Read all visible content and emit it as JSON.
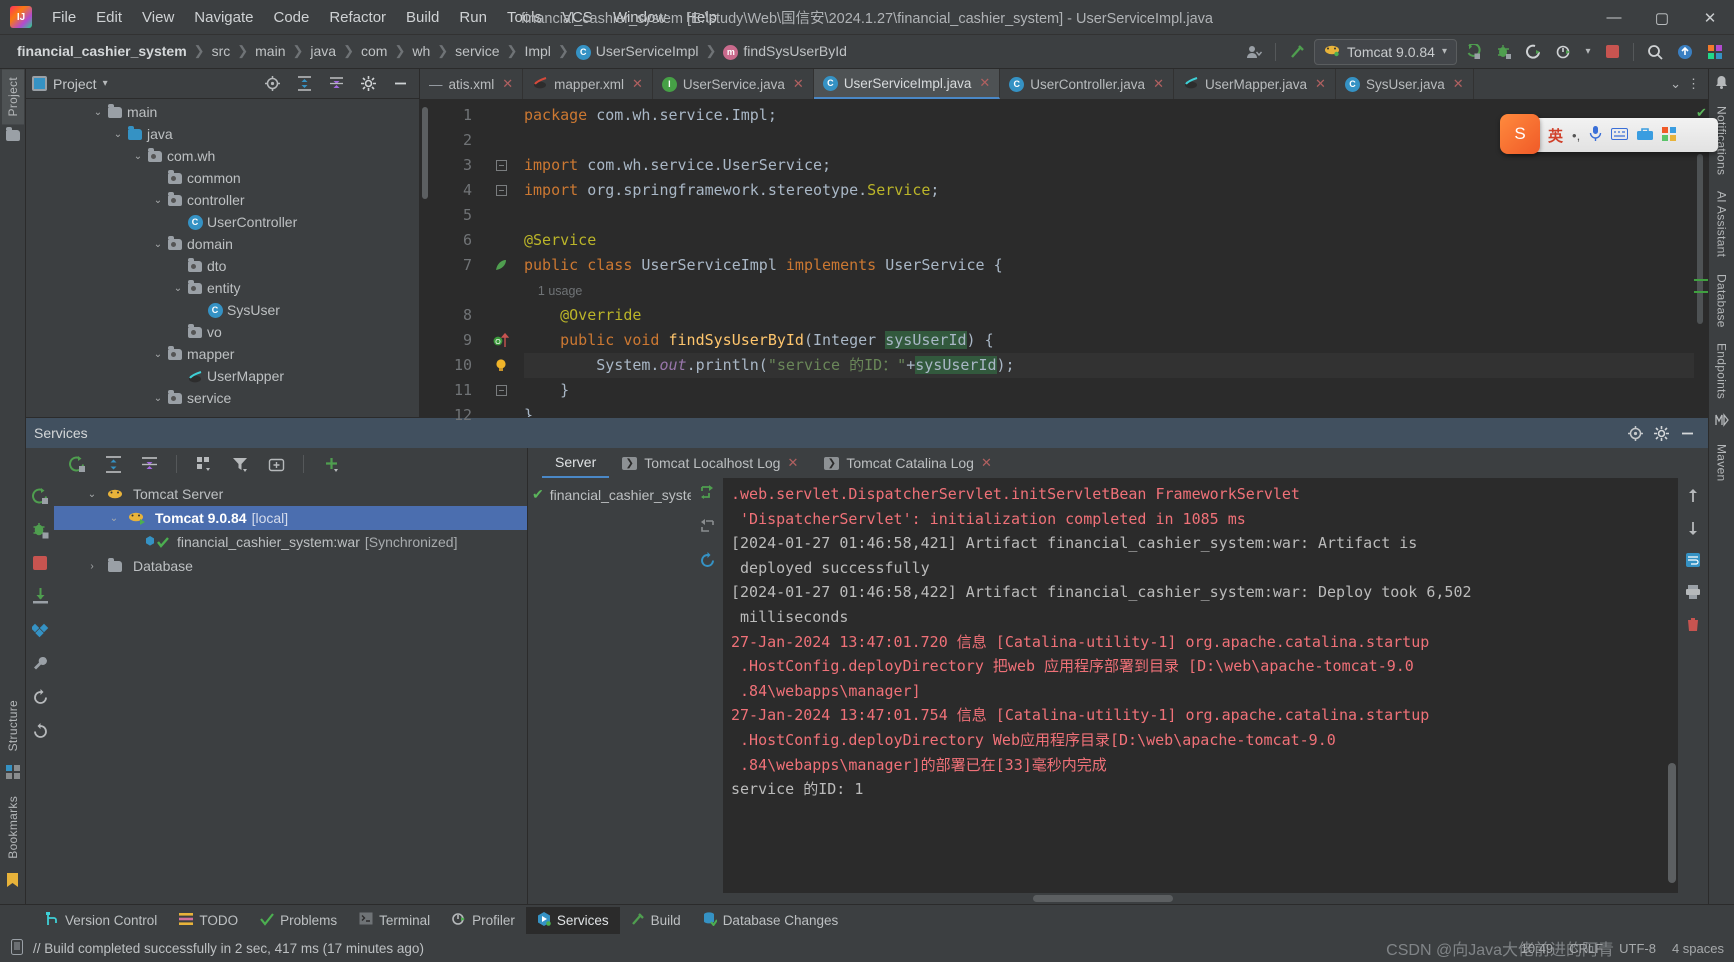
{
  "window": {
    "title": "financial_cashier_system [E:\\study\\Web\\国信安\\2024.1.27\\financial_cashier_system] - UserServiceImpl.java",
    "minimize": "—",
    "maximize": "▢",
    "close": "✕"
  },
  "menubar": [
    {
      "label": "File"
    },
    {
      "label": "Edit"
    },
    {
      "label": "View"
    },
    {
      "label": "Navigate"
    },
    {
      "label": "Code"
    },
    {
      "label": "Refactor"
    },
    {
      "label": "Build"
    },
    {
      "label": "Run"
    },
    {
      "label": "Tools"
    },
    {
      "label": "VCS"
    },
    {
      "label": "Window"
    },
    {
      "label": "Help"
    }
  ],
  "breadcrumb": [
    {
      "label": "financial_cashier_system",
      "icon": ""
    },
    {
      "label": "src",
      "icon": ""
    },
    {
      "label": "main",
      "icon": ""
    },
    {
      "label": "java",
      "icon": ""
    },
    {
      "label": "com",
      "icon": ""
    },
    {
      "label": "wh",
      "icon": ""
    },
    {
      "label": "service",
      "icon": ""
    },
    {
      "label": "Impl",
      "icon": ""
    },
    {
      "label": "UserServiceImpl",
      "icon": "C"
    },
    {
      "label": "findSysUserById",
      "icon": "m"
    }
  ],
  "navbar_right": {
    "account_icon": "account-icon",
    "build_icon": "build-hammer-icon",
    "run_config": "Tomcat 9.0.84",
    "run_icon": "run-icon",
    "debug_icon": "debug-icon",
    "rerun_icon": "rerun-icon",
    "profile_icon": "profile-icon",
    "stop_icon": "stop-icon",
    "search_icon": "search-icon",
    "update_icon": "update-icon"
  },
  "left_rail": [
    {
      "label": "Project",
      "active": true
    },
    {
      "label": "Structure",
      "active": false
    },
    {
      "label": "Bookmarks",
      "active": false
    }
  ],
  "right_rail": [
    {
      "label": "Notifications"
    },
    {
      "label": "AI Assistant"
    },
    {
      "label": "Database"
    },
    {
      "label": "Endpoints"
    },
    {
      "label": "Maven"
    }
  ],
  "project_panel": {
    "title": "Project",
    "tree": [
      {
        "depth": 3,
        "chevron": "v",
        "icon": "folder",
        "label": "main"
      },
      {
        "depth": 4,
        "chevron": "v",
        "icon": "folder-blue",
        "label": "java"
      },
      {
        "depth": 5,
        "chevron": "v",
        "icon": "package",
        "label": "com.wh"
      },
      {
        "depth": 6,
        "chevron": "",
        "icon": "package",
        "label": "common"
      },
      {
        "depth": 6,
        "chevron": "v",
        "icon": "package",
        "label": "controller"
      },
      {
        "depth": 7,
        "chevron": "",
        "icon": "class",
        "label": "UserController"
      },
      {
        "depth": 6,
        "chevron": "v",
        "icon": "package",
        "label": "domain"
      },
      {
        "depth": 7,
        "chevron": "",
        "icon": "package",
        "label": "dto"
      },
      {
        "depth": 7,
        "chevron": "v",
        "icon": "package",
        "label": "entity"
      },
      {
        "depth": 8,
        "chevron": "",
        "icon": "class",
        "label": "SysUser"
      },
      {
        "depth": 7,
        "chevron": "",
        "icon": "package",
        "label": "vo"
      },
      {
        "depth": 6,
        "chevron": "v",
        "icon": "package",
        "label": "mapper"
      },
      {
        "depth": 7,
        "chevron": "",
        "icon": "interface-java",
        "label": "UserMapper"
      },
      {
        "depth": 6,
        "chevron": "v",
        "icon": "package",
        "label": "service"
      }
    ]
  },
  "editor_tabs": [
    {
      "label": "atis.xml",
      "icon": "xml-icon",
      "active": false,
      "truncated": true
    },
    {
      "label": "mapper.xml",
      "icon": "mybatis-icon",
      "active": false
    },
    {
      "label": "UserService.java",
      "icon": "interface-icon",
      "active": false
    },
    {
      "label": "UserServiceImpl.java",
      "icon": "class-icon",
      "active": true
    },
    {
      "label": "UserController.java",
      "icon": "class-icon",
      "active": false
    },
    {
      "label": "UserMapper.java",
      "icon": "mybatis-mapper-icon",
      "active": false
    },
    {
      "label": "SysUser.java",
      "icon": "class-icon",
      "active": false
    }
  ],
  "editor": {
    "lines": [
      {
        "no": "1",
        "html": "<span class='kw'>package</span> com.wh.service.Impl;"
      },
      {
        "no": "2",
        "html": ""
      },
      {
        "no": "3",
        "html": "<span class='kw'>import</span> com.wh.service.UserService;"
      },
      {
        "no": "4",
        "html": "<span class='kw'>import</span> org.springframework.stereotype.<span class='ann'>Service</span>;"
      },
      {
        "no": "5",
        "html": ""
      },
      {
        "no": "6",
        "html": "<span class='ann'>@Service</span>"
      },
      {
        "no": "7",
        "html": "<span class='kw'>public class</span> UserServiceImpl <span class='kw'>implements</span> UserService {"
      },
      {
        "no": "",
        "html": "<span class='usage'>    1 usage</span>"
      },
      {
        "no": "8",
        "html": "    <span class='ann'>@Override</span>"
      },
      {
        "no": "9",
        "html": "    <span class='kw'>public void</span> <span class='fn'>findSysUserById</span>(Integer <span class='hl'>sysUserId</span>) {"
      },
      {
        "no": "10",
        "html": "        System.<span class='fld'>out</span>.println(<span class='str'>\"service 的ID：\"</span>+<span class='hl'>sysUserId</span>);"
      },
      {
        "no": "11",
        "html": "    }"
      },
      {
        "no": "12",
        "html": "}"
      }
    ],
    "usage_hint": "1 usage",
    "gutter_marks": [
      "",
      "",
      "fold",
      "fold",
      "",
      "",
      "spring-bean",
      "",
      "",
      "override-arrow",
      "intention-bulb",
      "fold-end",
      ""
    ]
  },
  "ime": {
    "app": "搜狗",
    "mode": "英",
    "items": [
      "英",
      "•,",
      "mic-icon",
      "keyboard-icon",
      "toolbox-icon",
      "apps-icon"
    ]
  },
  "services": {
    "title": "Services",
    "toolbar_icons": [
      "rerun-icon",
      "expand-all-icon",
      "collapse-all-icon",
      "group-by-icon",
      "filter-icon",
      "add-tab-icon",
      "add-icon"
    ],
    "rail_icons": [
      "rerun-icon",
      "debug-icon",
      "stop-icon",
      "deploy-icon",
      "settings-icon",
      "wrench-icon",
      "refresh-icon",
      "restart-icon"
    ],
    "tree": [
      {
        "depth": 1,
        "chevron": "v",
        "icon": "tomcat-icon",
        "label": "Tomcat Server",
        "suffix": "",
        "selected": false
      },
      {
        "depth": 2,
        "chevron": "v",
        "icon": "tomcat-run-icon",
        "label": "Tomcat 9.0.84",
        "suffix": "[local]",
        "selected": true
      },
      {
        "depth": 3,
        "chevron": "",
        "icon": "artifact-ok-icon",
        "label": "financial_cashier_system:war",
        "suffix": "[Synchronized]",
        "selected": false
      },
      {
        "depth": 1,
        "chevron": ">",
        "icon": "folder",
        "label": "Database",
        "suffix": "",
        "selected": false
      }
    ],
    "log_tabs": [
      {
        "label": "Server",
        "active": true,
        "closable": false,
        "icon": ""
      },
      {
        "label": "Tomcat Localhost Log",
        "active": false,
        "closable": true,
        "icon": "console-icon"
      },
      {
        "label": "Tomcat Catalina Log",
        "active": false,
        "closable": true,
        "icon": "console-icon"
      }
    ],
    "log_side": [
      {
        "label": "financial_cashier_syster",
        "icon": "check-icon"
      }
    ],
    "log_tools": [
      "scroll-to-end-icon",
      "scroll-to-source-icon",
      "rerun-icon"
    ],
    "console_lines": [
      {
        "cls": "err",
        "text": ".web.servlet.DispatcherServlet.initServletBean FrameworkServlet"
      },
      {
        "cls": "err",
        "text": " 'DispatcherServlet': initialization completed in 1085 ms"
      },
      {
        "cls": "out",
        "text": "[2024-01-27 01:46:58,421] Artifact financial_cashier_system:war: Artifact is"
      },
      {
        "cls": "out",
        "text": " deployed successfully"
      },
      {
        "cls": "out",
        "text": "[2024-01-27 01:46:58,422] Artifact financial_cashier_system:war: Deploy took 6,502"
      },
      {
        "cls": "out",
        "text": " milliseconds"
      },
      {
        "cls": "err",
        "text": "27-Jan-2024 13:47:01.720 信息 [Catalina-utility-1] org.apache.catalina.startup"
      },
      {
        "cls": "err",
        "text": " .HostConfig.deployDirectory 把web 应用程序部署到目录 [D:\\web\\apache-tomcat-9.0"
      },
      {
        "cls": "err",
        "text": " .84\\webapps\\manager]"
      },
      {
        "cls": "err",
        "text": "27-Jan-2024 13:47:01.754 信息 [Catalina-utility-1] org.apache.catalina.startup"
      },
      {
        "cls": "err",
        "text": " .HostConfig.deployDirectory Web应用程序目录[D:\\web\\apache-tomcat-9.0"
      },
      {
        "cls": "err",
        "text": " .84\\webapps\\manager]的部署已在[33]毫秒内完成"
      },
      {
        "cls": "out",
        "text": "service 的ID: 1"
      }
    ],
    "run_rail_icons": [
      "scroll-up-icon",
      "scroll-down-icon",
      "soft-wrap-icon",
      "print-icon",
      "clear-all-icon"
    ]
  },
  "bottom_toolbar": [
    {
      "label": "Version Control",
      "icon": "branch-icon",
      "active": false
    },
    {
      "label": "TODO",
      "icon": "todo-icon",
      "active": false
    },
    {
      "label": "Problems",
      "icon": "check-icon",
      "active": false
    },
    {
      "label": "Terminal",
      "icon": "terminal-icon",
      "active": false
    },
    {
      "label": "Profiler",
      "icon": "profiler-icon",
      "active": false
    },
    {
      "label": "Services",
      "icon": "services-icon",
      "active": true
    },
    {
      "label": "Build",
      "icon": "hammer-icon",
      "active": false
    },
    {
      "label": "Database Changes",
      "icon": "db-changes-icon",
      "active": false
    }
  ],
  "statusbar": {
    "icon": "memory-icon",
    "message": "// Build completed successfully in 2 sec, 417 ms (17 minutes ago)",
    "right": [
      "10:49",
      "CRLF",
      "UTF-8",
      "4 spaces"
    ],
    "watermark": "CSDN @向Java大佬前进的阿青"
  }
}
